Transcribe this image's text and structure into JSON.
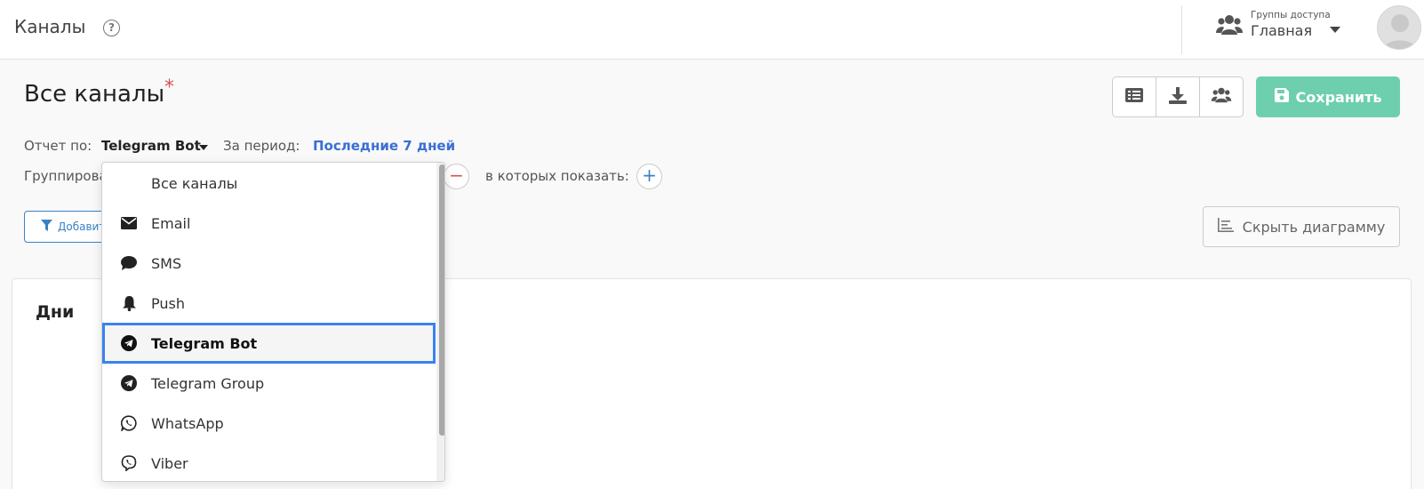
{
  "header": {
    "title": "Каналы",
    "help_icon": "question-circle-icon",
    "access_groups_label": "Группы доступа",
    "access_groups_value": "Главная"
  },
  "page": {
    "title": "Все каналы",
    "unsaved_marker": "*",
    "save_label": "Сохранить",
    "toolbar_icons": [
      "list-icon",
      "download-icon",
      "users-icon"
    ]
  },
  "report": {
    "label": "Отчет по:",
    "value": "Telegram Bot",
    "period_label": "За период:",
    "period_value": "Последние 7 дней"
  },
  "grouping": {
    "label": "Группирова",
    "show_label": "в которых показать:",
    "remove_symbol": "−",
    "add_symbol": "+"
  },
  "filter": {
    "add_label": "Добавить"
  },
  "chart_toggle": {
    "label": "Скрыть диаграмму"
  },
  "card": {
    "title": "Дни"
  },
  "dropdown": {
    "items": [
      {
        "label": "Все каналы",
        "icon": ""
      },
      {
        "label": "Email",
        "icon": "envelope-icon"
      },
      {
        "label": "SMS",
        "icon": "chat-bubble-icon"
      },
      {
        "label": "Push",
        "icon": "bell-icon"
      },
      {
        "label": "Telegram Bot",
        "icon": "telegram-icon",
        "selected": true
      },
      {
        "label": "Telegram Group",
        "icon": "telegram-icon"
      },
      {
        "label": "WhatsApp",
        "icon": "whatsapp-icon"
      },
      {
        "label": "Viber",
        "icon": "viber-icon"
      }
    ]
  },
  "colors": {
    "accent_blue": "#3b82f0",
    "save_green": "#6dcfae",
    "link_blue": "#3b6fd3",
    "danger_red": "#d9534f"
  }
}
